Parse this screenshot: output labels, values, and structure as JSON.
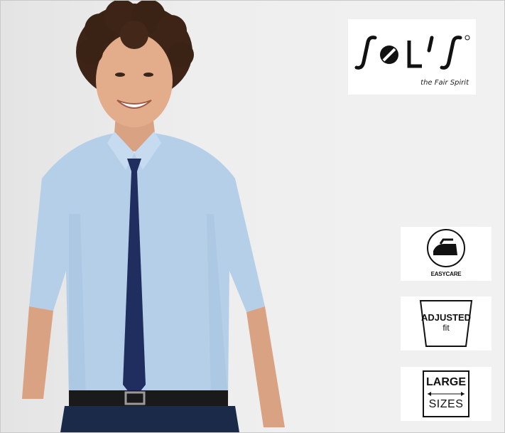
{
  "brand": {
    "logo_text": "SOL'S",
    "tagline": "the Fair Spirit"
  },
  "badges": {
    "easycare": "EASYCARE",
    "adjusted_line1": "ADJUSTED",
    "adjusted_line2": "fit",
    "large_line1": "LARGE",
    "large_line2": "SIZES"
  },
  "product_image": {
    "shirt_color": "#b5cfe8",
    "tie_color": "#1f2e5e",
    "trouser_color": "#1c2a4a"
  }
}
